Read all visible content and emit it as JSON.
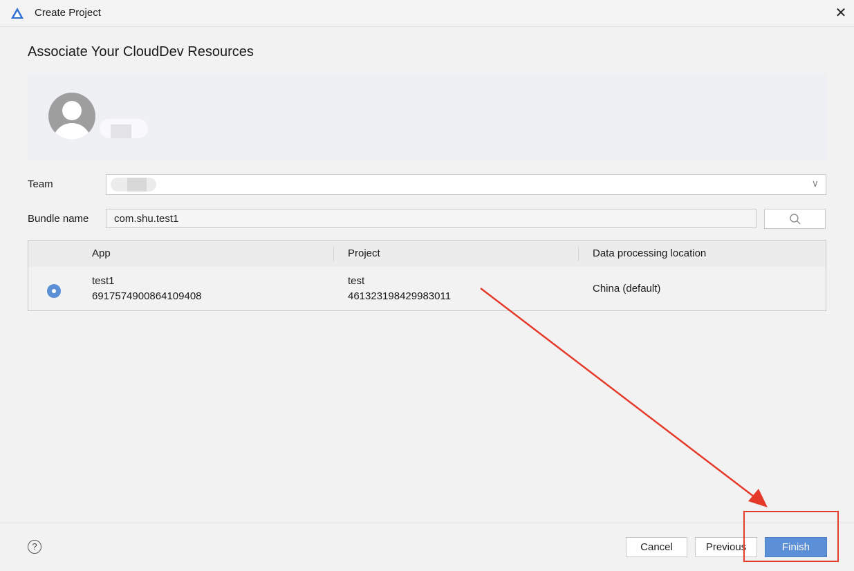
{
  "window": {
    "title": "Create Project",
    "close_icon": "close-icon",
    "app_icon": "deveco-logo-icon"
  },
  "heading": "Associate Your CloudDev Resources",
  "form": {
    "team_label": "Team",
    "team_value": "",
    "bundle_label": "Bundle name",
    "bundle_value": "com.shu.test1"
  },
  "table": {
    "columns": [
      "App",
      "Project",
      "Data processing location"
    ],
    "rows": [
      {
        "selected": true,
        "app_name": "test1",
        "app_id": "6917574900864109408",
        "project_name": "test",
        "project_id": "461323198429983011",
        "location": "China (default)"
      }
    ]
  },
  "footer": {
    "help": "?",
    "cancel": "Cancel",
    "previous": "Previous",
    "finish": "Finish"
  },
  "colors": {
    "accent": "#5b8fd6",
    "annotation": "#e53a2a"
  }
}
